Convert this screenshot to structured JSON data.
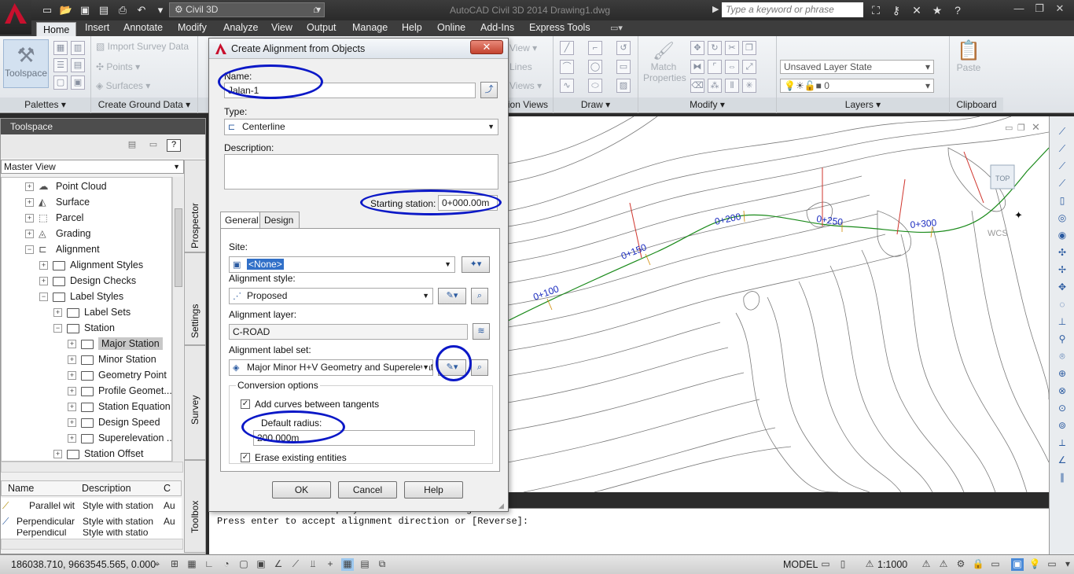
{
  "app": {
    "title": "AutoCAD Civil 3D 2014   Drawing1.dwg",
    "workspace": "Civil 3D",
    "search_placeholder": "Type a keyword or phrase"
  },
  "ribbon": {
    "tabs": [
      "Home",
      "Insert",
      "Annotate",
      "Modify",
      "Analyze",
      "View",
      "Output",
      "Manage",
      "Help",
      "Online",
      "Add-Ins",
      "Express Tools"
    ],
    "active_tab": "Home",
    "toolspace_label": "Toolspace",
    "ground_data": {
      "import_survey": "Import Survey Data",
      "points": "Points",
      "surfaces": "Surfaces"
    },
    "partial_labels": [
      "View",
      "Lines",
      "Views"
    ],
    "match_properties": "Match Properties",
    "layer_state": "Unsaved Layer State",
    "layer_current": "0",
    "paste_label": "Paste",
    "panels": [
      "Palettes",
      "Create Ground Data",
      "tion Views",
      "Draw",
      "Modify",
      "Layers",
      "Clipboard"
    ]
  },
  "toolspace": {
    "title": "Toolspace",
    "view_mode": "Master View",
    "help_btn": "?",
    "tree": [
      {
        "label": "Point Cloud",
        "indent": 0,
        "exp": "+",
        "icon": "cloud"
      },
      {
        "label": "Surface",
        "indent": 0,
        "exp": "+",
        "icon": "surface"
      },
      {
        "label": "Parcel",
        "indent": 0,
        "exp": "+",
        "icon": "parcel"
      },
      {
        "label": "Grading",
        "indent": 0,
        "exp": "+",
        "icon": "grading"
      },
      {
        "label": "Alignment",
        "indent": 0,
        "exp": "−",
        "icon": "alignment"
      },
      {
        "label": "Alignment Styles",
        "indent": 1,
        "exp": "+",
        "icon": "folder"
      },
      {
        "label": "Design Checks",
        "indent": 1,
        "exp": "+",
        "icon": "folder"
      },
      {
        "label": "Label Styles",
        "indent": 1,
        "exp": "−",
        "icon": "folder"
      },
      {
        "label": "Label Sets",
        "indent": 2,
        "exp": "+",
        "icon": "folder"
      },
      {
        "label": "Station",
        "indent": 2,
        "exp": "−",
        "icon": "folder"
      },
      {
        "label": "Major Station",
        "indent": 3,
        "exp": "+",
        "icon": "folder",
        "selected": true
      },
      {
        "label": "Minor Station",
        "indent": 3,
        "exp": "+",
        "icon": "folder"
      },
      {
        "label": "Geometry Point",
        "indent": 3,
        "exp": "+",
        "icon": "folder"
      },
      {
        "label": "Profile Geomet...",
        "indent": 3,
        "exp": "+",
        "icon": "folder"
      },
      {
        "label": "Station Equation",
        "indent": 3,
        "exp": "+",
        "icon": "folder"
      },
      {
        "label": "Design Speed",
        "indent": 3,
        "exp": "+",
        "icon": "folder"
      },
      {
        "label": "Superelevation ...",
        "indent": 3,
        "exp": "+",
        "icon": "folder"
      },
      {
        "label": "Station Offset",
        "indent": 2,
        "exp": "+",
        "icon": "folder"
      }
    ],
    "side_tabs": [
      "Prospector",
      "Settings",
      "Survey",
      "Toolbox"
    ],
    "list": {
      "columns": [
        "Name",
        "Description",
        "C"
      ],
      "rows": [
        {
          "name": "Parallel wit",
          "desc": "Style with station",
          "c": "Au"
        },
        {
          "name": "Perpendicular",
          "desc": "Style with station",
          "c": "Au"
        },
        {
          "name": "Perpendicul",
          "desc": "Style with statio",
          "c": "Au"
        }
      ]
    }
  },
  "dialog": {
    "title": "Create Alignment from Objects",
    "name_label": "Name:",
    "name_value": "Jalan-1",
    "type_label": "Type:",
    "type_value": "Centerline",
    "description_label": "Description:",
    "description_value": "",
    "starting_station_label": "Starting station:",
    "starting_station_value": "0+000.00m",
    "tabs": [
      "General",
      "Design Criteria"
    ],
    "active_tab": "General",
    "site_label": "Site:",
    "site_value": "<None>",
    "alignment_style_label": "Alignment style:",
    "alignment_style_value": "Proposed",
    "alignment_layer_label": "Alignment layer:",
    "alignment_layer_value": "C-ROAD",
    "label_set_label": "Alignment label set:",
    "label_set_value": "Major Minor H+V Geometry and Superelevatic",
    "conversion_label": "Conversion options",
    "add_curves_label": "Add curves between tangents",
    "add_curves_checked": true,
    "default_radius_label": "Default radius:",
    "default_radius_value": "200.000m",
    "erase_label": "Erase existing entities",
    "erase_checked": true,
    "buttons": {
      "ok": "OK",
      "cancel": "Cancel",
      "help": "Help"
    }
  },
  "canvas": {
    "stations": [
      "0+100",
      "0+150",
      "0+200",
      "0+250",
      "0+300"
    ],
    "wcs_label": "WCS",
    "top_label": "TOP"
  },
  "command": {
    "line1": "Select lines/arcs or polylines to create alignment:",
    "line2": "Press enter to accept alignment direction or [Reverse]:"
  },
  "status": {
    "coords": "186038.710, 9663545.565, 0.000",
    "model": "MODEL",
    "scale": "1:1000"
  },
  "colors": {
    "highlight": "#0b18c7",
    "alignment_line": "#1a8a1a",
    "station_text": "#1a2bbf",
    "profile_marks": "#d0342c"
  }
}
